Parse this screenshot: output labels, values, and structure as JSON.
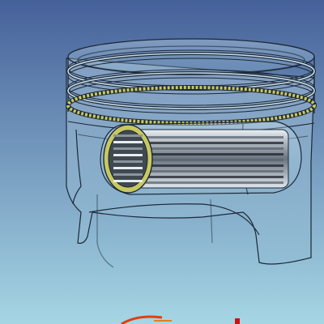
{
  "viewport": {
    "background_top": "#46619a",
    "background_bottom": "#a6d6e4"
  },
  "model": {
    "name": "piston-assembly",
    "display_mode": "transparent-wireframe",
    "parts": [
      "piston-crown",
      "compression-ring-top",
      "compression-ring-second",
      "oil-control-ring",
      "piston-skirt",
      "piston-pin",
      "pin-boss"
    ],
    "ring_color": "#c8c860",
    "edge_color": "#1c2838",
    "pin_color": "#404850"
  },
  "gizmo": {
    "type": "axis-triad",
    "colors": [
      "#e04010",
      "#e08020",
      "#d01010"
    ]
  }
}
